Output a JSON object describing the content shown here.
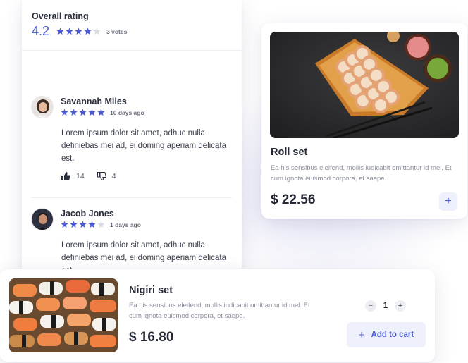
{
  "colors": {
    "accent": "#4b5bd6",
    "star_filled": "#4b5bd6",
    "star_empty": "#d9dbe3",
    "accent_soft": "#eef0fb"
  },
  "rating": {
    "title": "Overall rating",
    "value": "4.2",
    "stars": 4,
    "votes": "3 votes"
  },
  "reviews": [
    {
      "name": "Savannah Miles",
      "stars": 5,
      "date": "10 days ago",
      "text": "Lorem ipsum dolor sit amet, adhuc nulla definiebas mei ad, ei doming aperiam delicata est.",
      "likes": "14",
      "dislikes": "4"
    },
    {
      "name": "Jacob Jones",
      "stars": 4,
      "date": "1 days ago",
      "text": "Lorem ipsum dolor sit amet, adhuc nulla definiebas mei ad, ei doming aperiam delicata est."
    }
  ],
  "roll": {
    "title": "Roll set",
    "description": "Ea his sensibus eleifend, mollis iudicabit omittantur id mel. Et cum ignota euismod corpora, et saepe.",
    "price": "$ 22.56",
    "add_label": "+"
  },
  "nigiri": {
    "title": "Nigiri set",
    "description": "Ea his sensibus eleifend, mollis iudicabit omittantur id mel. Et cum ignota euismod corpora, et saepe.",
    "price": "$ 16.80",
    "quantity": "1",
    "minus_label": "−",
    "plus_label": "+",
    "cart_label": "Add to cart"
  }
}
